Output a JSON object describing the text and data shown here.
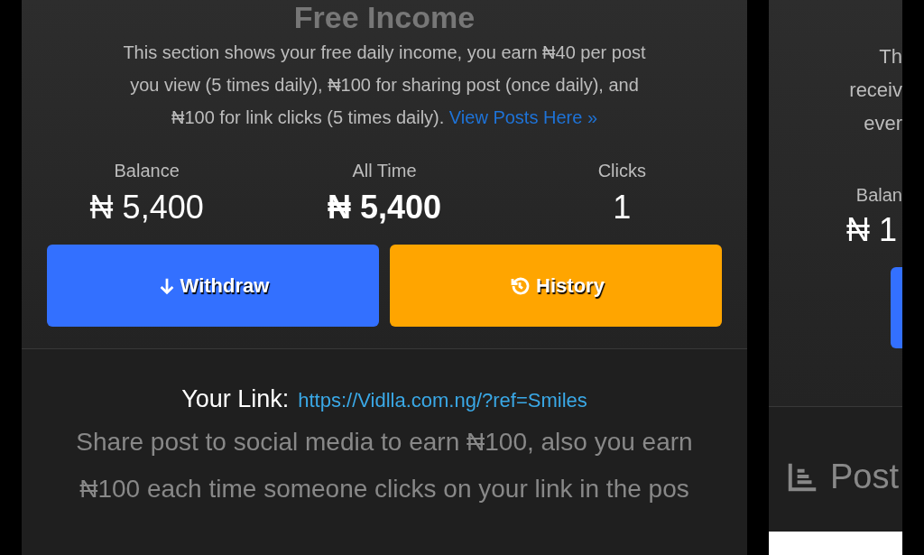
{
  "income": {
    "title": "Free Income",
    "description": "This section shows your free daily income, you earn ₦40 per post you view (5 times daily), ₦100 for sharing post (once daily), and ₦100 for link clicks (5 times daily).",
    "description_link": "View Posts Here »",
    "stats": [
      {
        "label": "Balance",
        "value": "₦ 5,400",
        "bold": false
      },
      {
        "label": "All Time",
        "value": "₦ 5,400",
        "bold": true
      },
      {
        "label": "Clicks",
        "value": "1",
        "bold": false
      }
    ],
    "buttons": [
      {
        "kind": "withdraw",
        "label": "Withdraw"
      },
      {
        "kind": "history",
        "label": "History"
      }
    ],
    "link_label": "Your Link:",
    "link": "https://Vidlla.com.ng/?ref=Smiles",
    "share_lines": [
      "Share post to social media to earn ₦100, also you earn",
      "₦100 each time someone clicks on your link in the pos"
    ]
  },
  "side": {
    "description_lines": [
      "Th",
      "receiv",
      "ever"
    ],
    "stat_label": "Balan",
    "stat_value": "₦ 1",
    "section_title": "Post"
  }
}
